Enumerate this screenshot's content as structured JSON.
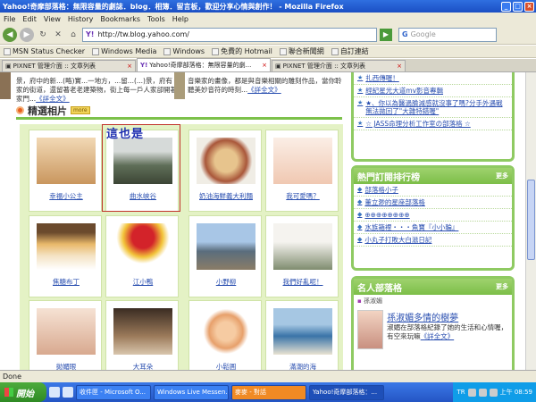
{
  "window": {
    "title": "Yahoo!奇摩部落格：無限容量的劇誌．blog．相簿．留言板，歡迎分享心情與創作！ - Mozilla Firefox"
  },
  "menu": [
    "File",
    "Edit",
    "View",
    "History",
    "Bookmarks",
    "Tools",
    "Help"
  ],
  "nav": {
    "url": "http://tw.blog.yahoo.com/",
    "search_placeholder": "Google"
  },
  "bookmarks": [
    "MSN Status Checker",
    "Windows Media",
    "Windows",
    "免費的 Hotmail",
    "聯合新聞網",
    "自訂連結"
  ],
  "tabs": [
    {
      "label": "PIXNET 管理介面 :: 文章列表",
      "active": false
    },
    {
      "label": "Yahoo!奇摩部落格：無限容量的劇...",
      "active": true
    },
    {
      "label": "PIXNET 管理介面 :: 文章列表",
      "active": false
    }
  ],
  "top_strip": {
    "left_text": "景，府中的新...(略)實...一地方，...留...(...)景，府有家的街道，還留著老老建築物，街上每一戶人家卻開著家門...",
    "left_link": "《詳全文》",
    "right_text": "音樂家的畫像，都是與音樂相關的雕刻作品，當你聆聽美妙音符的時刻...",
    "right_link": "《詳全文》"
  },
  "featured": {
    "title": "精選相片",
    "more": "more",
    "annotation": "這也是",
    "photos": [
      {
        "caption": "幸福小公主"
      },
      {
        "caption": "曲水峽谷"
      },
      {
        "caption": "奶油海鮮義大利麵"
      },
      {
        "caption": "我可愛嗎？"
      },
      {
        "caption": "焦糖布丁"
      },
      {
        "caption": "江小鴨"
      },
      {
        "caption": "小野柳"
      },
      {
        "caption": "我們好亂呢！"
      },
      {
        "caption": "拋媚眼"
      },
      {
        "caption": "大耳朵"
      },
      {
        "caption": "小鬆圓"
      },
      {
        "caption": "滿潮的海"
      }
    ]
  },
  "right_top_list": [
    "扎西傳喔！",
    "經紀星光大道mv影音專輯",
    "★、你以為醫過臉減感就沒事了嗎?分手外遇戰無法拋回了\"大雜特錯喔\"",
    "☆ JASS命理分析工作室の部落格 ☆"
  ],
  "hot": {
    "title": "熱門訂閱排行榜",
    "more": "更多",
    "items": [
      "部落格小子",
      "董立渺的星座部落格",
      "⊕⊕⊕⊕⊕⊕⊕⊕",
      "水族箱裡・・・魚寶『小小輪』",
      "小丸子打敗大白滋日記"
    ]
  },
  "famous": {
    "title": "名人部落格",
    "more": "更多",
    "label": "孫淑媚",
    "name": "孫淑媚多情的樹夢",
    "desc": "淑媚在部落格紀錄了她的生活和心情喔，有空來玩嘛",
    "link": "《詳全文》"
  },
  "status": "Done",
  "taskbar": {
    "start": "開始",
    "tasks": [
      {
        "label": "收件匣 - Microsoft O..."
      },
      {
        "label": "Windows Live Messen..."
      },
      {
        "label": "麥麥 - 對話"
      },
      {
        "label": "Yahoo!奇摩部落格：..."
      }
    ],
    "lang": "TR",
    "clock": "上午 08:59"
  },
  "colors": {
    "accent_green": "#8fca62",
    "link_blue": "#2a4fb0",
    "annotation_red": "#c1332b"
  }
}
